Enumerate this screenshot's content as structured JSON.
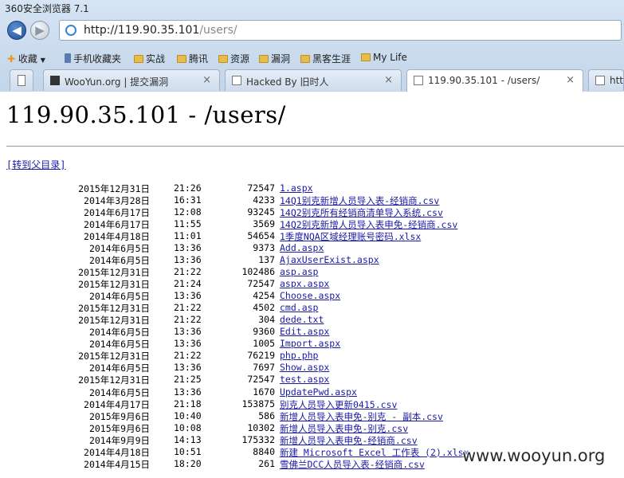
{
  "window": {
    "title": "360安全浏览器 7.1"
  },
  "address": {
    "url_host": "http://119.90.35.101",
    "url_path": "/users/"
  },
  "bookmarks": [
    "收藏",
    "手机收藏夹",
    "实战",
    "腾讯",
    "资源",
    "漏洞",
    "黑客生涯",
    "My Life"
  ],
  "tabs": [
    {
      "label": "WooYun.org | 提交漏洞",
      "close": "×"
    },
    {
      "label": "Hacked By 旧时人",
      "close": "×"
    },
    {
      "label": "119.90.35.101 - /users/",
      "close": "×"
    },
    {
      "label": "htt",
      "close": ""
    }
  ],
  "page": {
    "heading": "119.90.35.101 - /users/",
    "parent_link": "[转到父目录]",
    "entries": [
      {
        "date": "2015年12月31日",
        "time": "21:26",
        "size": "72547",
        "name": "1.aspx"
      },
      {
        "date": "2014年3月28日",
        "time": "16:31",
        "size": "4233",
        "name": "14Q1别克新增人员导入表-经销商.csv"
      },
      {
        "date": "2014年6月17日",
        "time": "12:08",
        "size": "93245",
        "name": "14Q2别克所有经销商清单导入系统.csv"
      },
      {
        "date": "2014年6月17日",
        "time": "11:55",
        "size": "3569",
        "name": "14Q2别克新增人员导入表申免-经销商.csv"
      },
      {
        "date": "2014年4月18日",
        "time": "11:01",
        "size": "54654",
        "name": "1季度NQA区域经理账号密码.xlsx"
      },
      {
        "date": "2014年6月5日",
        "time": "13:36",
        "size": "9373",
        "name": "Add.aspx"
      },
      {
        "date": "2014年6月5日",
        "time": "13:36",
        "size": "137",
        "name": "AjaxUserExist.aspx"
      },
      {
        "date": "2015年12月31日",
        "time": "21:22",
        "size": "102486",
        "name": "asp.asp"
      },
      {
        "date": "2015年12月31日",
        "time": "21:24",
        "size": "72547",
        "name": "aspx.aspx"
      },
      {
        "date": "2014年6月5日",
        "time": "13:36",
        "size": "4254",
        "name": "Choose.aspx"
      },
      {
        "date": "2015年12月31日",
        "time": "21:22",
        "size": "4502",
        "name": "cmd.asp"
      },
      {
        "date": "2015年12月31日",
        "time": "21:22",
        "size": "304",
        "name": "dede.txt"
      },
      {
        "date": "2014年6月5日",
        "time": "13:36",
        "size": "9360",
        "name": "Edit.aspx"
      },
      {
        "date": "2014年6月5日",
        "time": "13:36",
        "size": "1005",
        "name": "Import.aspx"
      },
      {
        "date": "2015年12月31日",
        "time": "21:22",
        "size": "76219",
        "name": "php.php"
      },
      {
        "date": "2014年6月5日",
        "time": "13:36",
        "size": "7697",
        "name": "Show.aspx"
      },
      {
        "date": "2015年12月31日",
        "time": "21:25",
        "size": "72547",
        "name": "test.aspx"
      },
      {
        "date": "2014年6月5日",
        "time": "13:36",
        "size": "1670",
        "name": "UpdatePwd.aspx"
      },
      {
        "date": "2014年4月17日",
        "time": "21:18",
        "size": "153875",
        "name": "别克人员导入更新0415.csv"
      },
      {
        "date": "2015年9月6日",
        "time": "10:40",
        "size": "586",
        "name": "新增人员导入表申免-别克 - 副本.csv"
      },
      {
        "date": "2015年9月6日",
        "time": "10:08",
        "size": "10302",
        "name": "新增人员导入表申免-别克.csv"
      },
      {
        "date": "2014年9月9日",
        "time": "14:13",
        "size": "175332",
        "name": "新增人员导入表申免-经销商.csv"
      },
      {
        "date": "2014年4月18日",
        "time": "10:51",
        "size": "8840",
        "name": "新建 Microsoft Excel 工作表 (2).xlsx"
      },
      {
        "date": "2014年4月15日",
        "time": "18:20",
        "size": "261",
        "name": "雪佛兰DCC人员导入表-经销商.csv"
      }
    ]
  },
  "watermark": "www.wooyun.org"
}
